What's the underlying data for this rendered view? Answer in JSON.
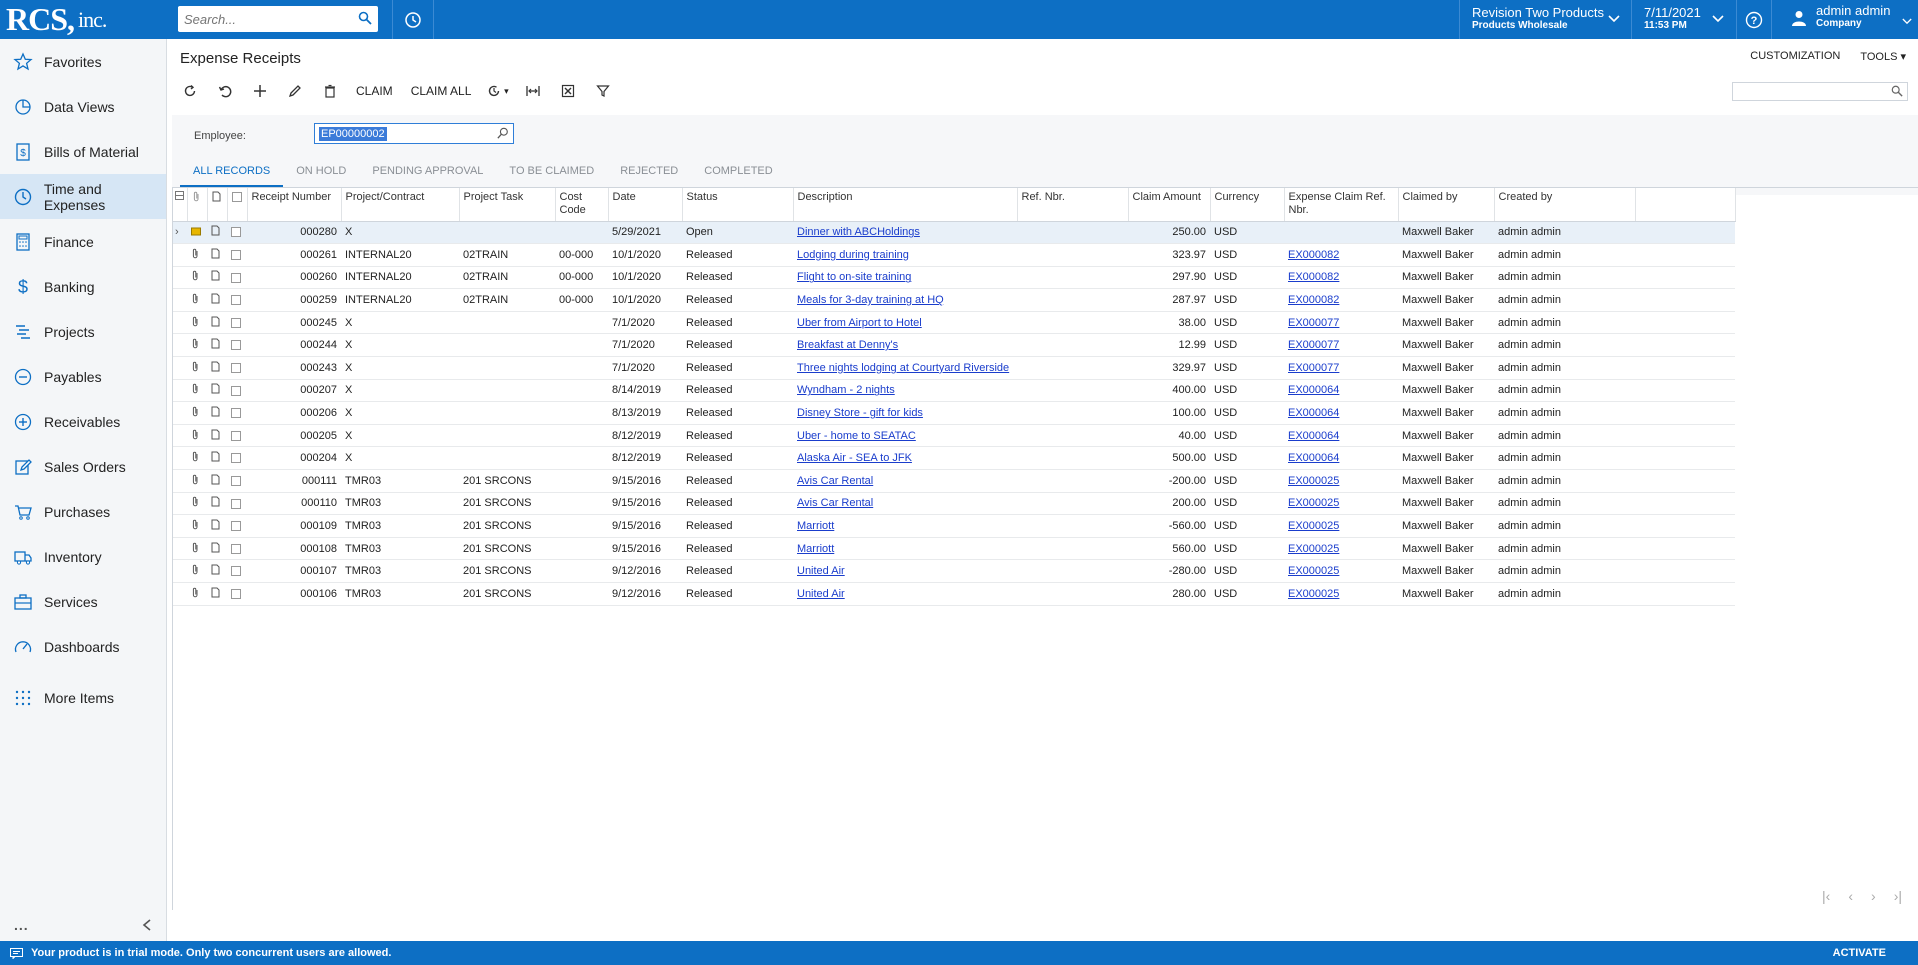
{
  "header": {
    "logo": "RCS,",
    "logo_suffix": "inc.",
    "search_placeholder": "Search...",
    "company_name": "Revision Two Products",
    "company_sub": "Products Wholesale",
    "date": "7/11/2021",
    "time": "11:53 PM",
    "user_name": "admin admin",
    "user_sub": "Company"
  },
  "sidebar": {
    "items": [
      {
        "label": "Favorites",
        "icon": "star-icon"
      },
      {
        "label": "Data Views",
        "icon": "pie-chart-icon"
      },
      {
        "label": "Bills of Material",
        "icon": "document-dollar-icon"
      },
      {
        "label": "Time and Expenses",
        "icon": "clock-icon"
      },
      {
        "label": "Finance",
        "icon": "calculator-icon"
      },
      {
        "label": "Banking",
        "icon": "dollar-icon"
      },
      {
        "label": "Projects",
        "icon": "gantt-icon"
      },
      {
        "label": "Payables",
        "icon": "minus-circle-icon"
      },
      {
        "label": "Receivables",
        "icon": "plus-circle-icon"
      },
      {
        "label": "Sales Orders",
        "icon": "edit-icon"
      },
      {
        "label": "Purchases",
        "icon": "cart-icon"
      },
      {
        "label": "Inventory",
        "icon": "truck-icon"
      },
      {
        "label": "Services",
        "icon": "briefcase-icon"
      },
      {
        "label": "Dashboards",
        "icon": "gauge-icon"
      },
      {
        "label": "More Items",
        "icon": "grid-dots-icon"
      }
    ],
    "more_label": "..."
  },
  "page": {
    "title": "Expense Receipts",
    "customization": "CUSTOMIZATION",
    "tools": "TOOLS",
    "claim": "CLAIM",
    "claim_all": "CLAIM ALL",
    "employee_label": "Employee:",
    "employee_value": "EP00000002"
  },
  "tabs": [
    "ALL RECORDS",
    "ON HOLD",
    "PENDING APPROVAL",
    "TO BE CLAIMED",
    "REJECTED",
    "COMPLETED"
  ],
  "columns": {
    "receipt": "Receipt Number",
    "project": "Project/Contract",
    "task": "Project Task",
    "cost": "Cost Code",
    "date": "Date",
    "status": "Status",
    "desc": "Description",
    "ref": "Ref. Nbr.",
    "amount": "Claim Amount",
    "currency": "Currency",
    "claim_ref": "Expense Claim Ref. Nbr.",
    "claimed_by": "Claimed by",
    "created_by": "Created by"
  },
  "rows": [
    {
      "receipt": "000280",
      "project": "X",
      "task": "",
      "cost": "",
      "date": "5/29/2021",
      "status": "Open",
      "desc": "Dinner with ABCHoldings",
      "ref": "",
      "amount": "250.00",
      "currency": "USD",
      "claim_ref": "",
      "claimed_by": "Maxwell Baker",
      "created_by": "admin admin"
    },
    {
      "receipt": "000261",
      "project": "INTERNAL20",
      "task": "02TRAIN",
      "cost": "00-000",
      "date": "10/1/2020",
      "status": "Released",
      "desc": "Lodging during training",
      "ref": "",
      "amount": "323.97",
      "currency": "USD",
      "claim_ref": "EX000082",
      "claimed_by": "Maxwell Baker",
      "created_by": "admin admin"
    },
    {
      "receipt": "000260",
      "project": "INTERNAL20",
      "task": "02TRAIN",
      "cost": "00-000",
      "date": "10/1/2020",
      "status": "Released",
      "desc": "Flight to on-site training",
      "ref": "",
      "amount": "297.90",
      "currency": "USD",
      "claim_ref": "EX000082",
      "claimed_by": "Maxwell Baker",
      "created_by": "admin admin"
    },
    {
      "receipt": "000259",
      "project": "INTERNAL20",
      "task": "02TRAIN",
      "cost": "00-000",
      "date": "10/1/2020",
      "status": "Released",
      "desc": "Meals for 3-day training at HQ",
      "ref": "",
      "amount": "287.97",
      "currency": "USD",
      "claim_ref": "EX000082",
      "claimed_by": "Maxwell Baker",
      "created_by": "admin admin"
    },
    {
      "receipt": "000245",
      "project": "X",
      "task": "",
      "cost": "",
      "date": "7/1/2020",
      "status": "Released",
      "desc": "Uber from Airport to Hotel",
      "ref": "",
      "amount": "38.00",
      "currency": "USD",
      "claim_ref": "EX000077",
      "claimed_by": "Maxwell Baker",
      "created_by": "admin admin"
    },
    {
      "receipt": "000244",
      "project": "X",
      "task": "",
      "cost": "",
      "date": "7/1/2020",
      "status": "Released",
      "desc": "Breakfast at Denny's",
      "ref": "",
      "amount": "12.99",
      "currency": "USD",
      "claim_ref": "EX000077",
      "claimed_by": "Maxwell Baker",
      "created_by": "admin admin"
    },
    {
      "receipt": "000243",
      "project": "X",
      "task": "",
      "cost": "",
      "date": "7/1/2020",
      "status": "Released",
      "desc": "Three nights lodging at Courtyard Riverside",
      "ref": "",
      "amount": "329.97",
      "currency": "USD",
      "claim_ref": "EX000077",
      "claimed_by": "Maxwell Baker",
      "created_by": "admin admin"
    },
    {
      "receipt": "000207",
      "project": "X",
      "task": "",
      "cost": "",
      "date": "8/14/2019",
      "status": "Released",
      "desc": "Wyndham - 2 nights",
      "ref": "",
      "amount": "400.00",
      "currency": "USD",
      "claim_ref": "EX000064",
      "claimed_by": "Maxwell Baker",
      "created_by": "admin admin"
    },
    {
      "receipt": "000206",
      "project": "X",
      "task": "",
      "cost": "",
      "date": "8/13/2019",
      "status": "Released",
      "desc": "Disney Store - gift for kids",
      "ref": "",
      "amount": "100.00",
      "currency": "USD",
      "claim_ref": "EX000064",
      "claimed_by": "Maxwell Baker",
      "created_by": "admin admin"
    },
    {
      "receipt": "000205",
      "project": "X",
      "task": "",
      "cost": "",
      "date": "8/12/2019",
      "status": "Released",
      "desc": "Uber - home to SEATAC",
      "ref": "",
      "amount": "40.00",
      "currency": "USD",
      "claim_ref": "EX000064",
      "claimed_by": "Maxwell Baker",
      "created_by": "admin admin"
    },
    {
      "receipt": "000204",
      "project": "X",
      "task": "",
      "cost": "",
      "date": "8/12/2019",
      "status": "Released",
      "desc": "Alaska Air - SEA to JFK",
      "ref": "",
      "amount": "500.00",
      "currency": "USD",
      "claim_ref": "EX000064",
      "claimed_by": "Maxwell Baker",
      "created_by": "admin admin"
    },
    {
      "receipt": "000111",
      "project": "TMR03",
      "task": "201 SRCONS",
      "cost": "",
      "date": "9/15/2016",
      "status": "Released",
      "desc": "Avis Car Rental",
      "ref": "",
      "amount": "-200.00",
      "currency": "USD",
      "claim_ref": "EX000025",
      "claimed_by": "Maxwell Baker",
      "created_by": "admin admin"
    },
    {
      "receipt": "000110",
      "project": "TMR03",
      "task": "201 SRCONS",
      "cost": "",
      "date": "9/15/2016",
      "status": "Released",
      "desc": "Avis Car Rental",
      "ref": "",
      "amount": "200.00",
      "currency": "USD",
      "claim_ref": "EX000025",
      "claimed_by": "Maxwell Baker",
      "created_by": "admin admin"
    },
    {
      "receipt": "000109",
      "project": "TMR03",
      "task": "201 SRCONS",
      "cost": "",
      "date": "9/15/2016",
      "status": "Released",
      "desc": "Marriott",
      "ref": "",
      "amount": "-560.00",
      "currency": "USD",
      "claim_ref": "EX000025",
      "claimed_by": "Maxwell Baker",
      "created_by": "admin admin"
    },
    {
      "receipt": "000108",
      "project": "TMR03",
      "task": "201 SRCONS",
      "cost": "",
      "date": "9/15/2016",
      "status": "Released",
      "desc": "Marriott",
      "ref": "",
      "amount": "560.00",
      "currency": "USD",
      "claim_ref": "EX000025",
      "claimed_by": "Maxwell Baker",
      "created_by": "admin admin"
    },
    {
      "receipt": "000107",
      "project": "TMR03",
      "task": "201 SRCONS",
      "cost": "",
      "date": "9/12/2016",
      "status": "Released",
      "desc": "United Air",
      "ref": "",
      "amount": "-280.00",
      "currency": "USD",
      "claim_ref": "EX000025",
      "claimed_by": "Maxwell Baker",
      "created_by": "admin admin"
    },
    {
      "receipt": "000106",
      "project": "TMR03",
      "task": "201 SRCONS",
      "cost": "",
      "date": "9/12/2016",
      "status": "Released",
      "desc": "United Air",
      "ref": "",
      "amount": "280.00",
      "currency": "USD",
      "claim_ref": "EX000025",
      "claimed_by": "Maxwell Baker",
      "created_by": "admin admin"
    }
  ],
  "footer": {
    "trial_message": "Your product is in trial mode. Only two concurrent users are allowed.",
    "activate": "ACTIVATE"
  },
  "colors": {
    "brand": "#0d6fc4",
    "link": "#1a3dcc"
  }
}
